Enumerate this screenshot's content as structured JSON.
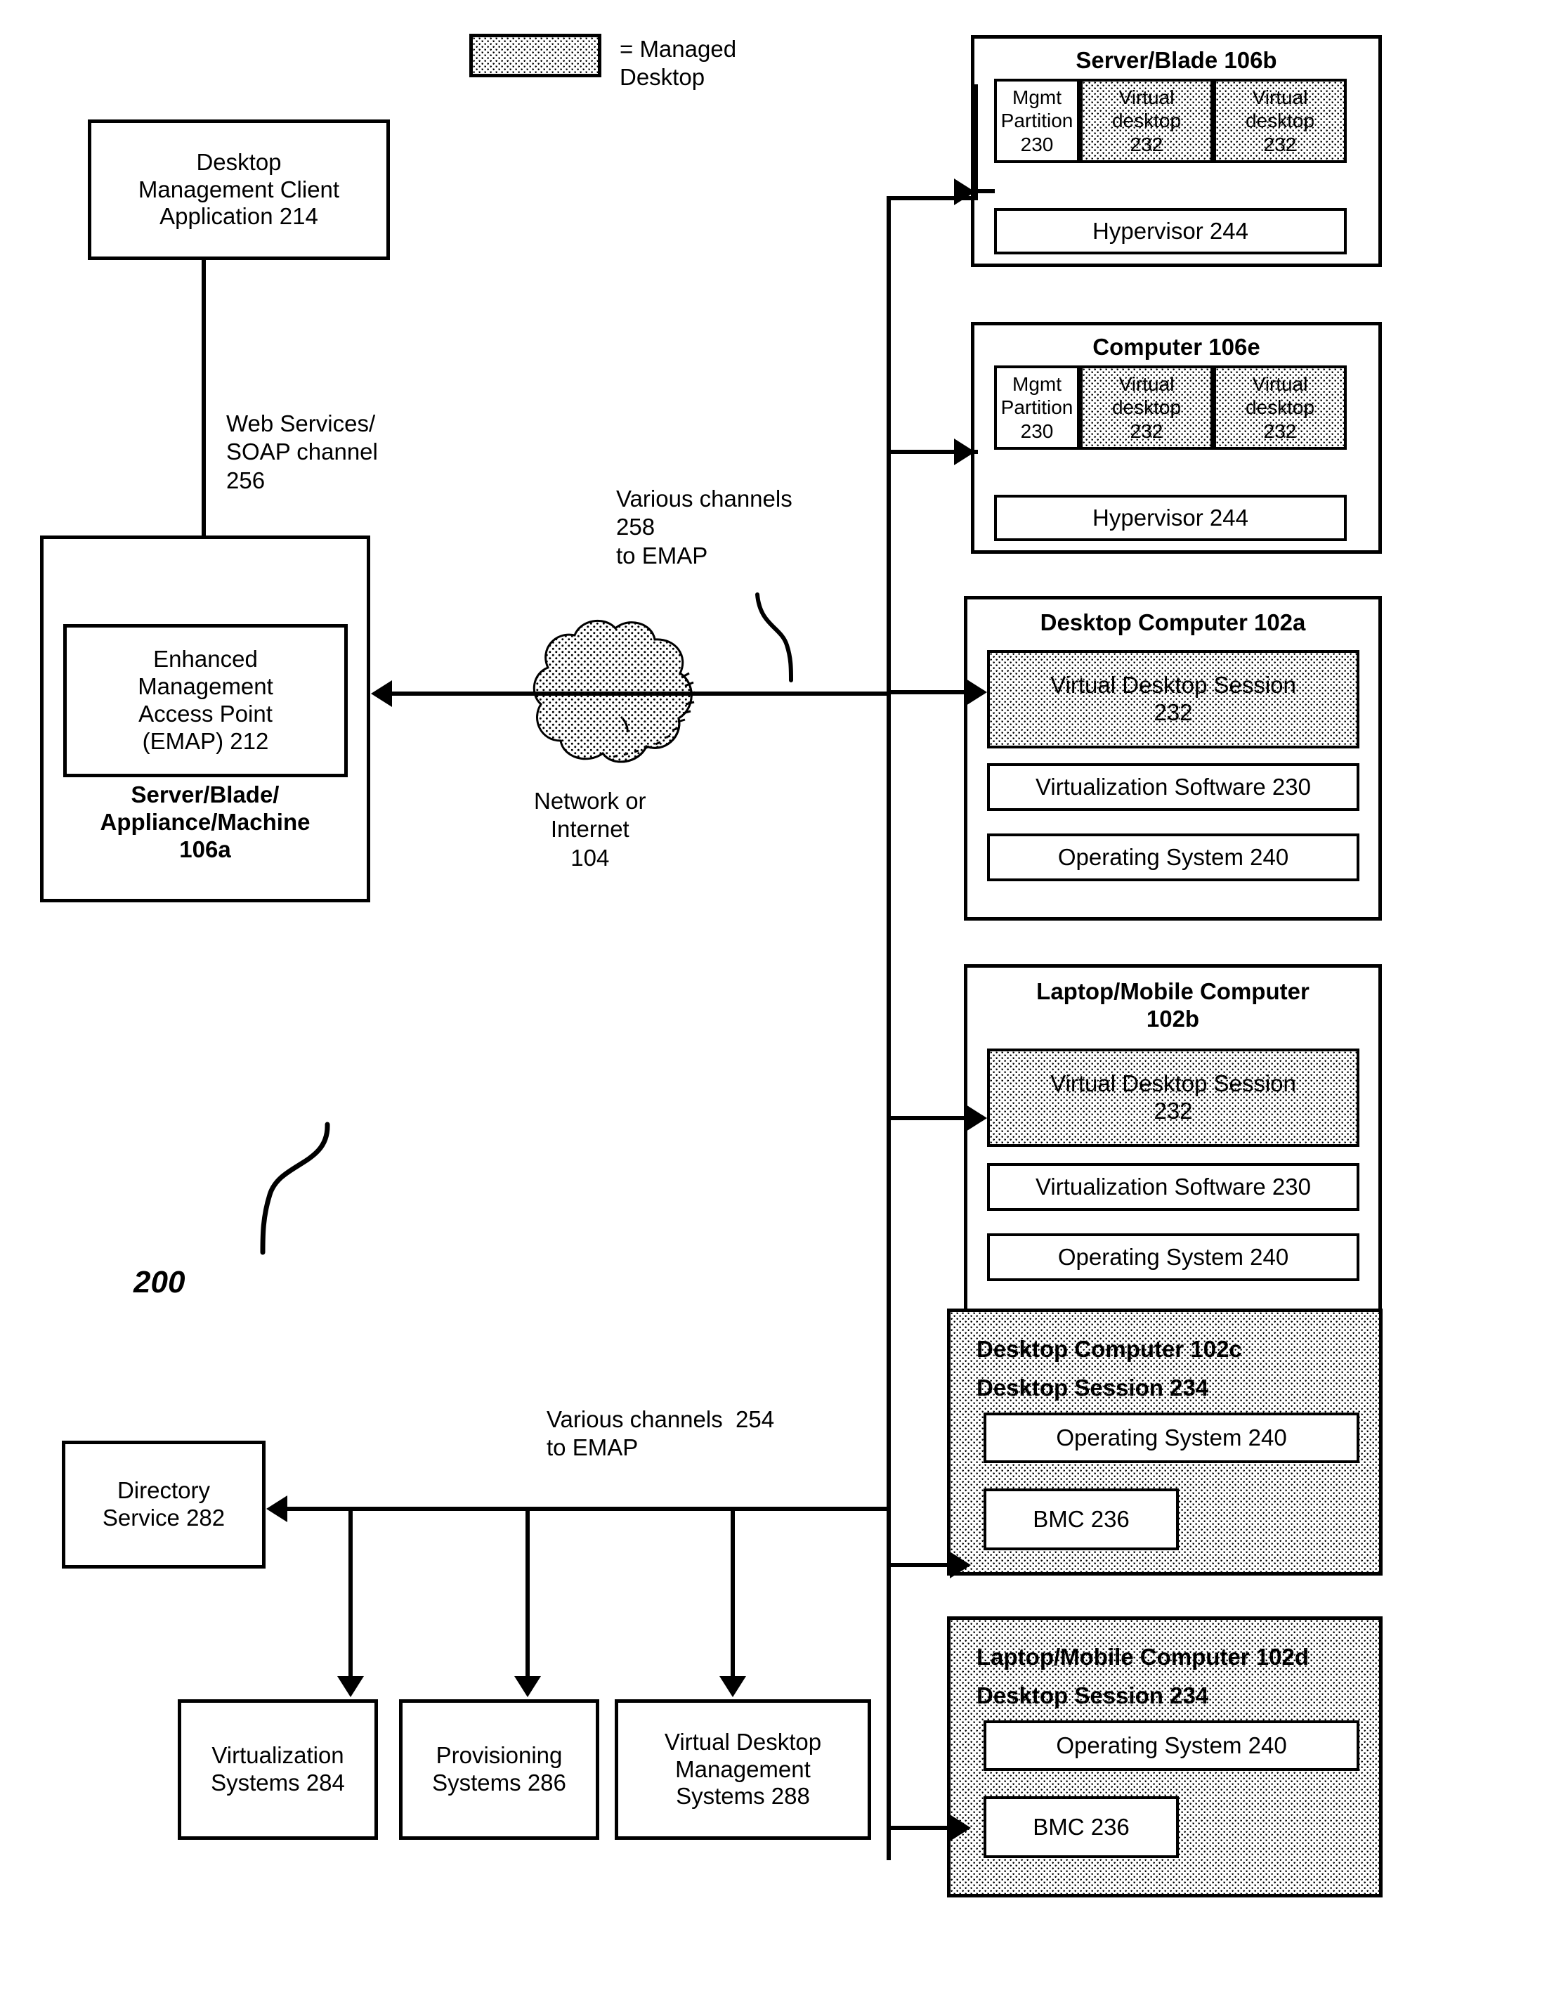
{
  "figure": {
    "number": "200"
  },
  "legend": {
    "swatch_name": "managed-desktop-swatch",
    "text": "= Managed\nDesktop"
  },
  "client": {
    "title": "Desktop\nManagement Client\nApplication 214"
  },
  "channels": {
    "web_services": "Web Services/\nSOAP channel\n256",
    "various_258": "Various channels\n258\nto EMAP",
    "various_254": "Various channels  254\nto EMAP"
  },
  "emap": {
    "inner_title": "Enhanced\nManagement\nAccess Point\n(EMAP) 212",
    "outer_title": "Server/Blade/\nAppliance/Machine\n106a"
  },
  "network": {
    "label": "Network or\nInternet\n104"
  },
  "server_blade_106b": {
    "title": "Server/Blade 106b",
    "cells": [
      {
        "text": "Mgmt\nPartition\n230",
        "managed": false
      },
      {
        "text": "Virtual\ndesktop\n232",
        "managed": true
      },
      {
        "text": "Virtual\ndesktop\n232",
        "managed": true
      }
    ],
    "hypervisor": "Hypervisor 244"
  },
  "computer_106e": {
    "title": "Computer 106e",
    "cells": [
      {
        "text": "Mgmt\nPartition\n230",
        "managed": false
      },
      {
        "text": "Virtual\ndesktop\n232",
        "managed": true
      },
      {
        "text": "Virtual\ndesktop\n232",
        "managed": true
      }
    ],
    "hypervisor": "Hypervisor 244"
  },
  "desktop_102a": {
    "title": "Desktop Computer 102a",
    "rows": [
      {
        "text": "Virtual Desktop Session\n232",
        "managed": true
      },
      {
        "text": "Virtualization Software 230",
        "managed": false
      },
      {
        "text": "Operating System 240",
        "managed": false
      }
    ]
  },
  "laptop_102b": {
    "title": "Laptop/Mobile Computer\n102b",
    "rows": [
      {
        "text": "Virtual Desktop Session\n232",
        "managed": true
      },
      {
        "text": "Virtualization Software 230",
        "managed": false
      },
      {
        "text": "Operating System 240",
        "managed": false
      }
    ]
  },
  "desktop_102c": {
    "title_line1": "Desktop Computer 102c",
    "title_line2": "Desktop Session 234",
    "managed": true,
    "rows": [
      {
        "text": "Operating System 240"
      },
      {
        "text": "BMC 236"
      }
    ]
  },
  "laptop_102d": {
    "title_line1": "Laptop/Mobile Computer 102d",
    "title_line2": "Desktop Session 234",
    "managed": true,
    "rows": [
      {
        "text": "Operating System 240"
      },
      {
        "text": "BMC 236"
      }
    ]
  },
  "backend": {
    "directory_service": "Directory\nService 282",
    "items": [
      {
        "text": "Virtualization\nSystems 284"
      },
      {
        "text": "Provisioning\nSystems 286"
      },
      {
        "text": "Virtual Desktop\nManagement\nSystems 288"
      }
    ]
  },
  "colors": {
    "ink": "#000000",
    "paper": "#ffffff"
  }
}
